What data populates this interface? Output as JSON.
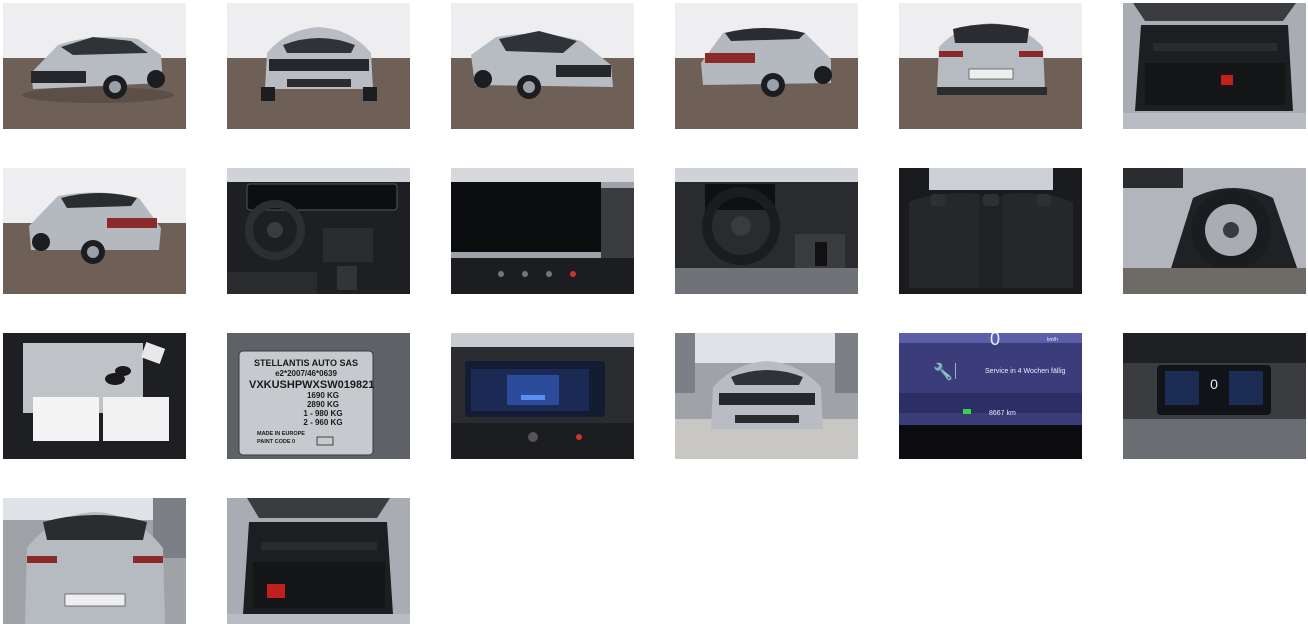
{
  "gallery": {
    "photos": [
      {
        "view": "front-left-exterior"
      },
      {
        "view": "front-exterior"
      },
      {
        "view": "front-right-exterior"
      },
      {
        "view": "rear-right-exterior"
      },
      {
        "view": "rear-exterior"
      },
      {
        "view": "trunk-interior"
      },
      {
        "view": "rear-left-exterior"
      },
      {
        "view": "dashboard-interior"
      },
      {
        "view": "infotainment-screen-off"
      },
      {
        "view": "steering-wheel-interior"
      },
      {
        "view": "rear-seats"
      },
      {
        "view": "wheel-closeup"
      },
      {
        "view": "keys-and-documents"
      },
      {
        "view": "type-plate"
      },
      {
        "view": "infotainment-screen-on"
      },
      {
        "view": "front-exterior-showroom"
      },
      {
        "view": "instrument-service-message"
      },
      {
        "view": "instrument-cluster"
      },
      {
        "view": "rear-exterior-showroom"
      },
      {
        "view": "trunk-interior-2"
      }
    ],
    "plate": {
      "maker": "STELLANTIS AUTO SAS",
      "approval": "e2*2007/46*0639",
      "vin": "VXKUSHPWXSW019821",
      "w1": "1690 KG",
      "w2": "2890 KG",
      "w3": "1 - 980  KG",
      "w4": "2 - 960  KG",
      "origin": "MADE IN EUROPE",
      "paint": "PAINT CODE 0"
    },
    "cluster": {
      "speed": "0",
      "unit": "km/h",
      "service_message": "Service in 4 Wochen fällig",
      "odometer": "8667 km"
    },
    "colors": {
      "showroom_floor": "#6e5f57",
      "showroom_wall": "#f2f2f4",
      "car_body": "#b4b8bf",
      "car_dark": "#2a2c30",
      "cluster_screen": "#3b3d7a"
    }
  }
}
